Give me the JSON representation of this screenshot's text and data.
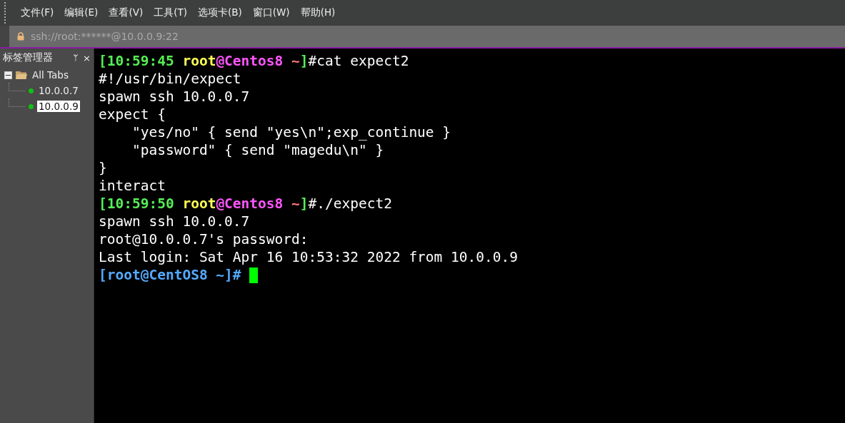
{
  "menu": [
    "文件(F)",
    "编辑(E)",
    "查看(V)",
    "工具(T)",
    "选项卡(B)",
    "窗口(W)",
    "帮助(H)"
  ],
  "address": {
    "value": "ssh://root:******@10.0.0.9:22"
  },
  "sidebar": {
    "title": "标签管理器",
    "pin": "ᛘ",
    "close": "×",
    "tree": {
      "label": "All Tabs",
      "expanded": true,
      "children": [
        {
          "label": "10.0.0.7",
          "selected": false,
          "color": "#11c011"
        },
        {
          "label": "10.0.0.9",
          "selected": true,
          "color": "#11c011"
        }
      ]
    }
  },
  "terminal": {
    "lines": [
      [
        {
          "text": "[10:59:45 ",
          "color": "#55ee55",
          "bold": true
        },
        {
          "text": "root",
          "color": "#ffff55",
          "bold": true
        },
        {
          "text": "@Centos8 ",
          "color": "#ff55ff",
          "bold": true
        },
        {
          "text": "~",
          "color": "#ff7777",
          "bold": true
        },
        {
          "text": "]",
          "color": "#55ee55",
          "bold": true
        },
        {
          "text": "#cat expect2",
          "color": "#ffffff",
          "bold": false
        }
      ],
      [
        {
          "text": "#!/usr/bin/expect",
          "color": "#ffffff",
          "bold": false
        }
      ],
      [
        {
          "text": "spawn ssh 10.0.0.7",
          "color": "#ffffff",
          "bold": false
        }
      ],
      [
        {
          "text": "expect {",
          "color": "#ffffff",
          "bold": false
        }
      ],
      [
        {
          "text": "    \"yes/no\" { send \"yes\\n\";exp_continue }",
          "color": "#ffffff",
          "bold": false
        }
      ],
      [
        {
          "text": "    \"password\" { send \"magedu\\n\" }",
          "color": "#ffffff",
          "bold": false
        }
      ],
      [
        {
          "text": "}",
          "color": "#ffffff",
          "bold": false
        }
      ],
      [
        {
          "text": "interact",
          "color": "#ffffff",
          "bold": false
        }
      ],
      [
        {
          "text": "[10:59:50 ",
          "color": "#55ee55",
          "bold": true
        },
        {
          "text": "root",
          "color": "#ffff55",
          "bold": true
        },
        {
          "text": "@Centos8 ",
          "color": "#ff55ff",
          "bold": true
        },
        {
          "text": "~",
          "color": "#ff7777",
          "bold": true
        },
        {
          "text": "]",
          "color": "#55ee55",
          "bold": true
        },
        {
          "text": "#./expect2",
          "color": "#ffffff",
          "bold": false
        }
      ],
      [
        {
          "text": "spawn ssh 10.0.0.7",
          "color": "#ffffff",
          "bold": false
        }
      ],
      [
        {
          "text": "root@10.0.0.7's password:",
          "color": "#ffffff",
          "bold": false
        }
      ],
      [
        {
          "text": "Last login: Sat Apr 16 10:53:32 2022 from 10.0.0.9",
          "color": "#ffffff",
          "bold": false
        }
      ],
      [
        {
          "text": "[root@CentOS8 ~]# ",
          "color": "#55aaff",
          "bold": true
        }
      ]
    ]
  }
}
